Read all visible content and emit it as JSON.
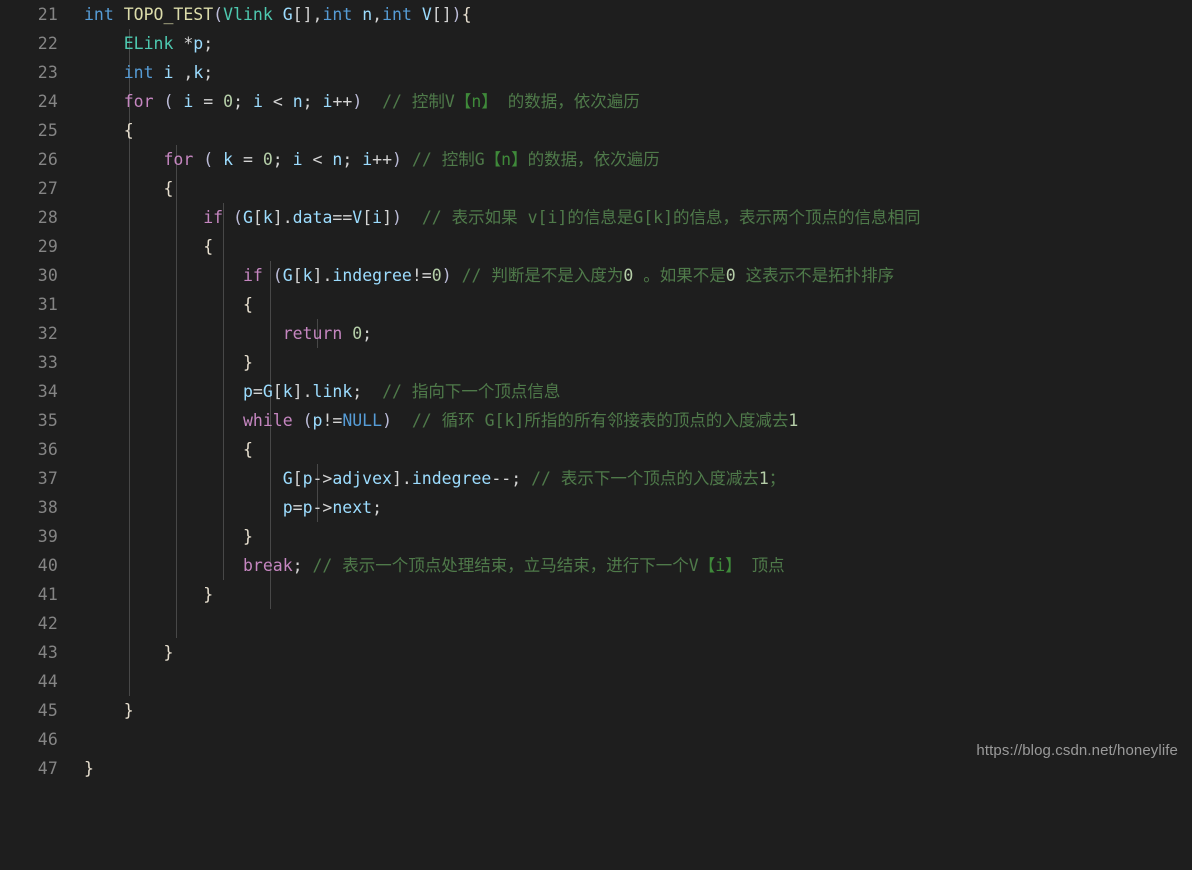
{
  "editor": {
    "background_color": "#1e1e1e",
    "gutter_color": "#858585",
    "first_line_number": 21,
    "last_line_number": 47
  },
  "watermark": {
    "text": "https://blog.csdn.net/honeylife"
  },
  "lines": [
    {
      "n": "21",
      "indent": 0,
      "text": "int TOPO_TEST(Vlink G[],int n,int V[]){"
    },
    {
      "n": "22",
      "indent": 1,
      "text": "ELink *p;"
    },
    {
      "n": "23",
      "indent": 1,
      "text": "int i ,k;"
    },
    {
      "n": "24",
      "indent": 1,
      "text": "for ( i = 0; i < n; i++)  // 控制V【n】 的数据，依次遍历"
    },
    {
      "n": "25",
      "indent": 1,
      "text": "{"
    },
    {
      "n": "26",
      "indent": 2,
      "text": "for ( k = 0; i < n; i++) // 控制G【n】的数据，依次遍历"
    },
    {
      "n": "27",
      "indent": 2,
      "text": "{"
    },
    {
      "n": "28",
      "indent": 3,
      "text": "if (G[k].data==V[i])  // 表示如果 v[i]的信息是G[k]的信息，表示两个顶点的信息相同"
    },
    {
      "n": "29",
      "indent": 3,
      "text": "{"
    },
    {
      "n": "30",
      "indent": 4,
      "text": "if (G[k].indegree!=0) // 判断是不是入度为0 。如果不是0 这表示不是拓扑排序"
    },
    {
      "n": "31",
      "indent": 4,
      "text": "{"
    },
    {
      "n": "32",
      "indent": 5,
      "text": "return 0;"
    },
    {
      "n": "33",
      "indent": 4,
      "text": "}"
    },
    {
      "n": "34",
      "indent": 4,
      "text": "p=G[k].link;  // 指向下一个顶点信息"
    },
    {
      "n": "35",
      "indent": 4,
      "text": "while (p!=NULL)  // 循环 G[k]所指的所有邻接表的顶点的入度减去1"
    },
    {
      "n": "36",
      "indent": 4,
      "text": "{"
    },
    {
      "n": "37",
      "indent": 5,
      "text": "G[p->adjvex].indegree--; // 表示下一个顶点的入度减去1；"
    },
    {
      "n": "38",
      "indent": 5,
      "text": "p=p->next;"
    },
    {
      "n": "39",
      "indent": 4,
      "text": "}"
    },
    {
      "n": "40",
      "indent": 4,
      "text": "break; // 表示一个顶点处理结束，立马结束，进行下一个V【i】顶点"
    },
    {
      "n": "41",
      "indent": 3,
      "text": "}"
    },
    {
      "n": "42",
      "indent": 0,
      "text": ""
    },
    {
      "n": "43",
      "indent": 2,
      "text": "}"
    },
    {
      "n": "44",
      "indent": 0,
      "text": ""
    },
    {
      "n": "45",
      "indent": 1,
      "text": "}"
    },
    {
      "n": "46",
      "indent": 0,
      "text": ""
    },
    {
      "n": "47",
      "indent": 0,
      "text": "}"
    }
  ],
  "colors": {
    "keyword_type": "#569cd6",
    "keyword_control": "#c586c0",
    "function": "#dcdcaa",
    "type_name": "#4ec9b0",
    "variable": "#9cdcfe",
    "number": "#b5cea8",
    "comment": "#4f7a4a",
    "comment_bracket": "#3f8a3a",
    "brace": "#e8e0d0",
    "gutter": "#858585",
    "watermark": "#9a9a9a"
  }
}
